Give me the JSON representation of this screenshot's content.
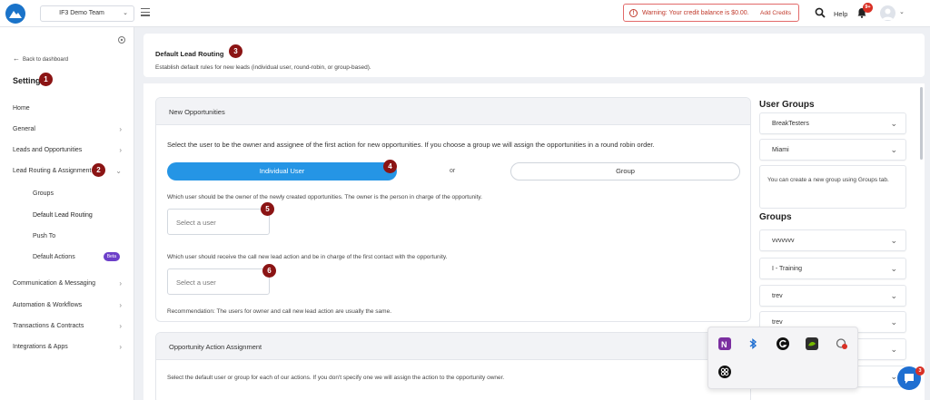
{
  "topbar": {
    "team": "IF3 Demo Team",
    "warning_text": "Warning: Your credit balance is $0.00.",
    "add_credits": "Add Credits",
    "help": "Help",
    "notification_count": "9+"
  },
  "sidebar": {
    "back_label": "Back to dashboard",
    "title": "Settings",
    "items": [
      {
        "label": "Home"
      },
      {
        "label": "General"
      },
      {
        "label": "Leads and Opportunities"
      },
      {
        "label": "Lead Routing & Assignment"
      },
      {
        "label": "Groups"
      },
      {
        "label": "Default Lead Routing"
      },
      {
        "label": "Push To"
      },
      {
        "label": "Default Actions",
        "badge": "Beta"
      },
      {
        "label": "Communication & Messaging"
      },
      {
        "label": "Automation & Workflows"
      },
      {
        "label": "Transactions & Contracts"
      },
      {
        "label": "Integrations & Apps"
      }
    ]
  },
  "callouts": [
    "1",
    "2",
    "3",
    "4",
    "5",
    "6"
  ],
  "header": {
    "title": "Default Lead Routing",
    "description": "Establish default rules for new leads (individual user, round-robin, or group-based)."
  },
  "new_opportunities": {
    "title": "New Opportunities",
    "instruction": "Select the user to be the owner and assignee of the first action for new opportunities. If you choose a group we will assign the opportunities in a round robin order.",
    "toggle_individual": "Individual User",
    "or": "or",
    "toggle_group": "Group",
    "owner_question": "Which user should be the owner of the newly created opportunities. The owner is the person in charge of the opportunity.",
    "owner_placeholder": "Select a user",
    "call_question": "Which user should receive the call new lead action and be in charge of the first contact with the opportunity.",
    "call_placeholder": "Select a user",
    "recommendation": "Recommendation: The users for owner and call new lead action are usually the same."
  },
  "action_assignment": {
    "title": "Opportunity Action Assignment",
    "description": "Select the default user or group for each of our actions. If you don't specify one we will assign the action to the opportunity owner."
  },
  "user_groups": {
    "title": "User Groups",
    "items": [
      "BreakTesters",
      "Miami"
    ],
    "note": "You can create a new group using Groups tab."
  },
  "groups": {
    "title": "Groups",
    "items": [
      "vvvvvvv",
      "I - Training",
      "trev",
      "trev"
    ]
  },
  "chat": {
    "badge": "3"
  },
  "colors": {
    "primary": "#2595e5",
    "callout": "#8b1414",
    "warning": "#c0392b",
    "beta": "#6c3fc9"
  }
}
